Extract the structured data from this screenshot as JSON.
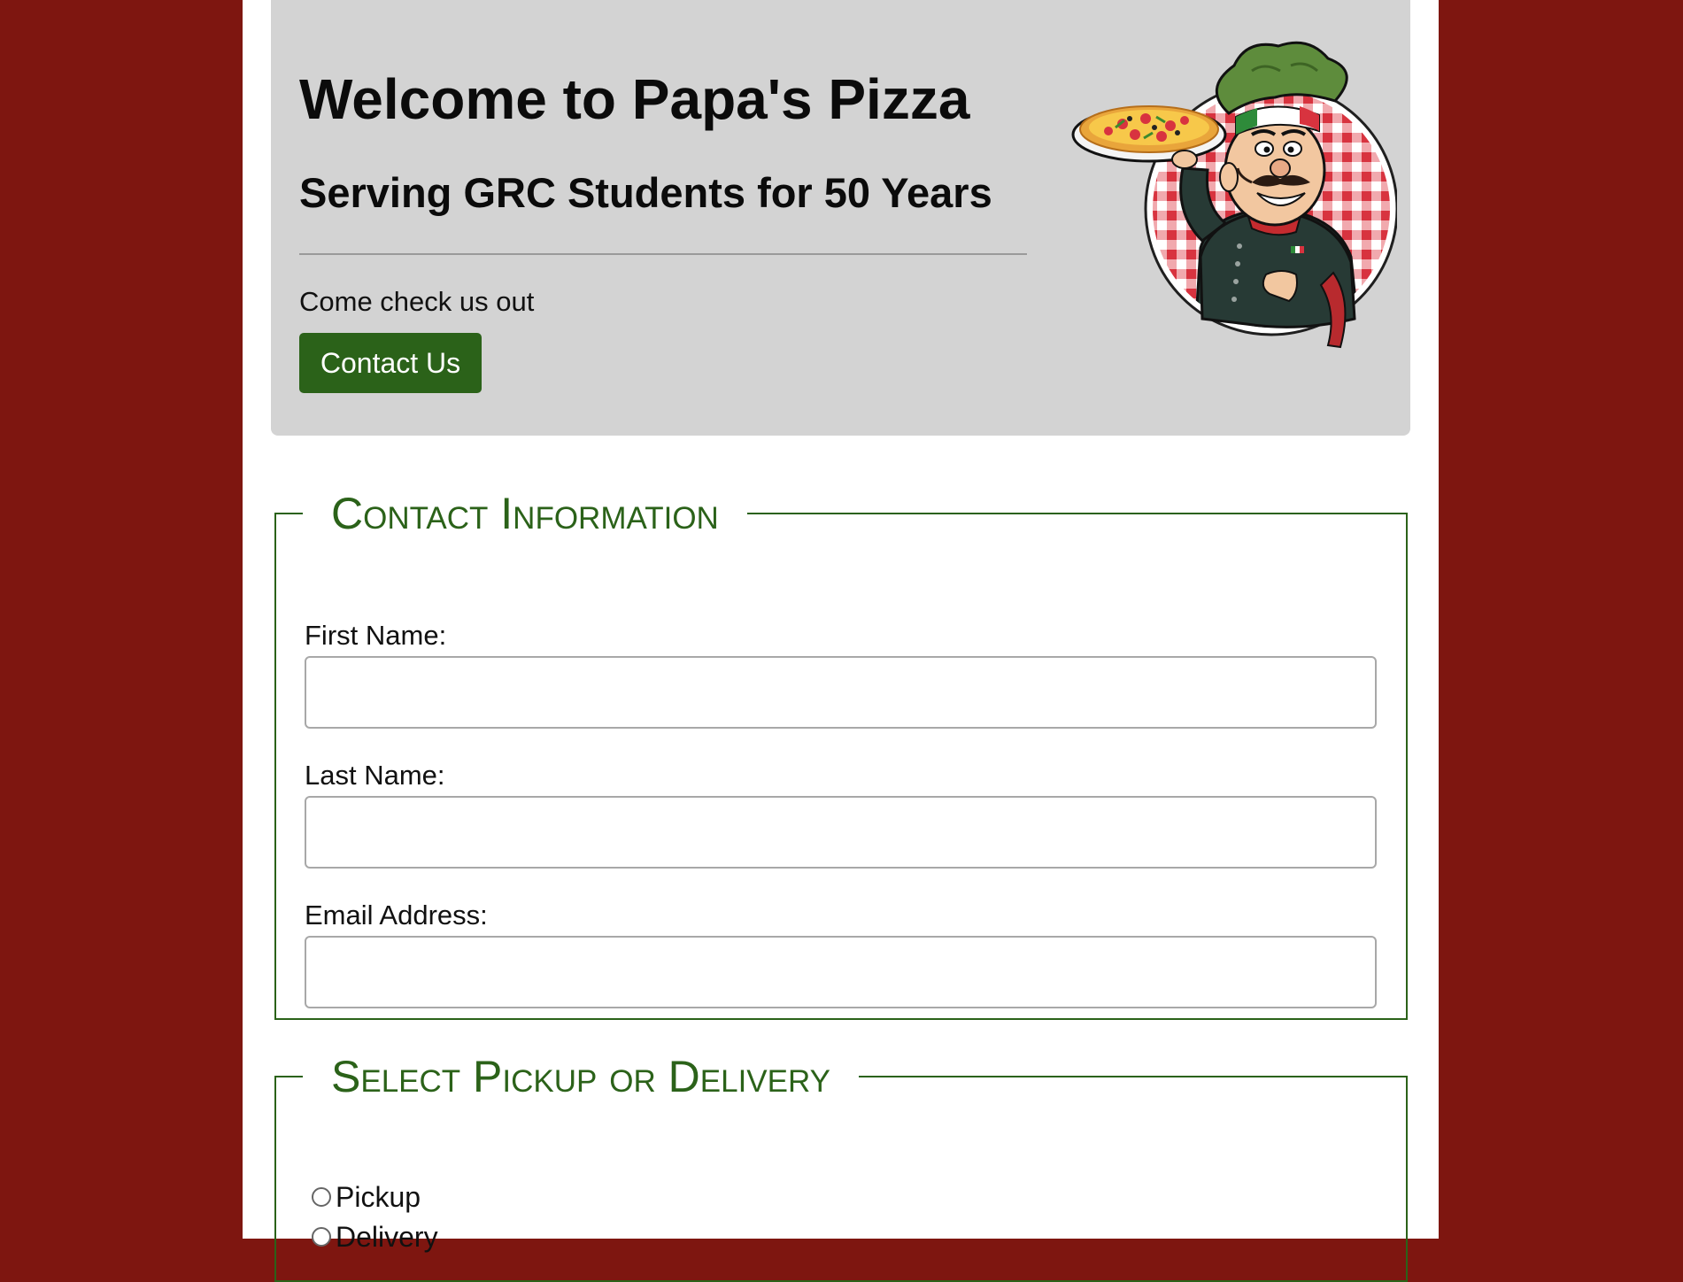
{
  "header": {
    "title": "Welcome to Papa's Pizza",
    "subtitle": "Serving GRC Students for 50 Years",
    "lead": "Come check us out",
    "contact_button": "Contact Us"
  },
  "contact_info": {
    "legend": "Contact Information",
    "fields": [
      {
        "label": "First Name:",
        "value": "",
        "placeholder": ""
      },
      {
        "label": "Last Name:",
        "value": "",
        "placeholder": ""
      },
      {
        "label": "Email Address:",
        "value": "",
        "placeholder": ""
      }
    ]
  },
  "pickup_delivery": {
    "legend": "Select Pickup or Delivery",
    "options": [
      {
        "label": "Pickup",
        "selected": false
      },
      {
        "label": "Delivery",
        "selected": false
      }
    ]
  },
  "colors": {
    "page_background": "#7e1610",
    "brand_green": "#2b6219",
    "jumbotron_background": "#d3d3d3"
  },
  "icons": {
    "chef": "chef-mascot-illustration"
  }
}
